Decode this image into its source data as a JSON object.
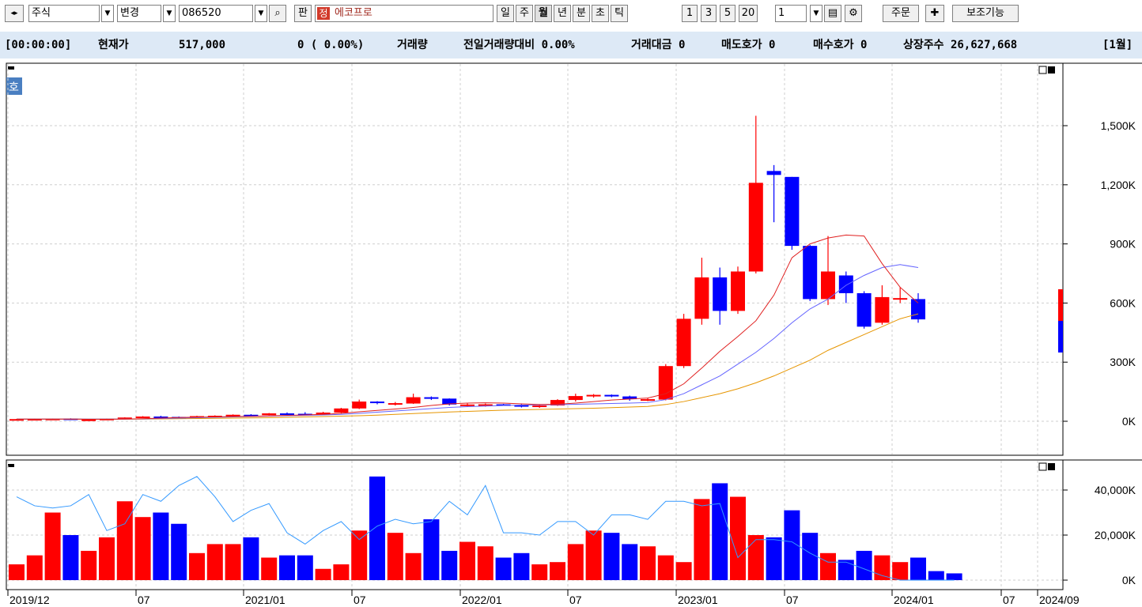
{
  "toolbar": {
    "market": "주식",
    "mode": "변경",
    "code": "086520",
    "pan_label": "판",
    "name_badge": "정",
    "stock_name": "에코프로",
    "periods": [
      "일",
      "주",
      "월",
      "년",
      "분",
      "초",
      "틱"
    ],
    "active_period": "월",
    "ranges": [
      "1",
      "3",
      "5",
      "20"
    ],
    "count": "1",
    "order_label": "주문",
    "aux_label": "보조기능"
  },
  "infobar": {
    "time": "[00:00:00]",
    "price_label": "현재가",
    "price": "517,000",
    "change": "0 ( 0.00%)",
    "volume_label": "거래량",
    "vol_ratio": "전일거래량대비 0.00%",
    "value_traded": "거래대금 0",
    "ask": "매도호가 0",
    "bid": "매수호가 0",
    "shares": "상장주수 26,627,668",
    "period": "[1월]"
  },
  "chart_data": {
    "type": "candlestick",
    "y_ticks": [
      "1,500K",
      "1,200K",
      "900K",
      "600K",
      "300K",
      "0K"
    ],
    "vol_ticks": [
      "40,000K",
      "20,000K",
      "0K"
    ],
    "x_labels": [
      "2019/12",
      "07",
      "2021/01",
      "07",
      "2022/01",
      "07",
      "2023/01",
      "07",
      "2024/01",
      "07",
      "2024/09"
    ],
    "candles": [
      {
        "o": 11,
        "h": 12,
        "l": 10,
        "c": 11,
        "up": true
      },
      {
        "o": 12,
        "h": 13,
        "l": 11,
        "c": 12,
        "up": true
      },
      {
        "o": 13,
        "h": 14,
        "l": 11,
        "c": 12,
        "up": true
      },
      {
        "o": 14,
        "h": 15,
        "l": 6,
        "c": 7,
        "up": false
      },
      {
        "o": 8,
        "h": 10,
        "l": 6,
        "c": 9,
        "up": true
      },
      {
        "o": 10,
        "h": 14,
        "l": 9,
        "c": 13,
        "up": true
      },
      {
        "o": 13,
        "h": 20,
        "l": 12,
        "c": 19,
        "up": true
      },
      {
        "o": 19,
        "h": 26,
        "l": 18,
        "c": 24,
        "up": true
      },
      {
        "o": 24,
        "h": 28,
        "l": 20,
        "c": 22,
        "up": false
      },
      {
        "o": 22,
        "h": 24,
        "l": 18,
        "c": 20,
        "up": false
      },
      {
        "o": 20,
        "h": 28,
        "l": 19,
        "c": 26,
        "up": true
      },
      {
        "o": 26,
        "h": 30,
        "l": 24,
        "c": 28,
        "up": true
      },
      {
        "o": 28,
        "h": 35,
        "l": 27,
        "c": 33,
        "up": true
      },
      {
        "o": 33,
        "h": 36,
        "l": 29,
        "c": 31,
        "up": false
      },
      {
        "o": 31,
        "h": 42,
        "l": 30,
        "c": 40,
        "up": true
      },
      {
        "o": 40,
        "h": 45,
        "l": 36,
        "c": 38,
        "up": false
      },
      {
        "o": 38,
        "h": 46,
        "l": 33,
        "c": 35,
        "up": false
      },
      {
        "o": 35,
        "h": 48,
        "l": 33,
        "c": 44,
        "up": true
      },
      {
        "o": 44,
        "h": 68,
        "l": 42,
        "c": 65,
        "up": true
      },
      {
        "o": 65,
        "h": 110,
        "l": 62,
        "c": 100,
        "up": true
      },
      {
        "o": 100,
        "h": 102,
        "l": 86,
        "c": 92,
        "up": false
      },
      {
        "o": 92,
        "h": 98,
        "l": 80,
        "c": 90,
        "up": true
      },
      {
        "o": 90,
        "h": 140,
        "l": 88,
        "c": 122,
        "up": true
      },
      {
        "o": 122,
        "h": 126,
        "l": 108,
        "c": 115,
        "up": false
      },
      {
        "o": 115,
        "h": 116,
        "l": 80,
        "c": 85,
        "up": false
      },
      {
        "o": 85,
        "h": 90,
        "l": 75,
        "c": 80,
        "up": true
      },
      {
        "o": 80,
        "h": 90,
        "l": 74,
        "c": 86,
        "up": true
      },
      {
        "o": 86,
        "h": 88,
        "l": 80,
        "c": 82,
        "up": false
      },
      {
        "o": 82,
        "h": 88,
        "l": 70,
        "c": 75,
        "up": false
      },
      {
        "o": 75,
        "h": 85,
        "l": 68,
        "c": 80,
        "up": true
      },
      {
        "o": 80,
        "h": 112,
        "l": 78,
        "c": 108,
        "up": true
      },
      {
        "o": 108,
        "h": 140,
        "l": 100,
        "c": 128,
        "up": true
      },
      {
        "o": 128,
        "h": 138,
        "l": 120,
        "c": 134,
        "up": true
      },
      {
        "o": 134,
        "h": 136,
        "l": 122,
        "c": 126,
        "up": false
      },
      {
        "o": 126,
        "h": 130,
        "l": 104,
        "c": 112,
        "up": false
      },
      {
        "o": 112,
        "h": 118,
        "l": 102,
        "c": 110,
        "up": true
      },
      {
        "o": 110,
        "h": 290,
        "l": 106,
        "c": 280,
        "up": true
      },
      {
        "o": 280,
        "h": 545,
        "l": 270,
        "c": 520,
        "up": true
      },
      {
        "o": 520,
        "h": 830,
        "l": 490,
        "c": 730,
        "up": true
      },
      {
        "o": 730,
        "h": 780,
        "l": 490,
        "c": 560,
        "up": false
      },
      {
        "o": 560,
        "h": 785,
        "l": 545,
        "c": 760,
        "up": true
      },
      {
        "o": 760,
        "h": 1550,
        "l": 750,
        "c": 1210,
        "up": true
      },
      {
        "o": 1270,
        "h": 1300,
        "l": 1010,
        "c": 1250,
        "up": false
      },
      {
        "o": 1240,
        "h": 1240,
        "l": 870,
        "c": 890,
        "up": false
      },
      {
        "o": 890,
        "h": 895,
        "l": 610,
        "c": 620,
        "up": false
      },
      {
        "o": 620,
        "h": 940,
        "l": 590,
        "c": 760,
        "up": true
      },
      {
        "o": 740,
        "h": 760,
        "l": 600,
        "c": 650,
        "up": false
      },
      {
        "o": 650,
        "h": 660,
        "l": 470,
        "c": 480,
        "up": false
      },
      {
        "o": 500,
        "h": 690,
        "l": 490,
        "c": 630,
        "up": true
      },
      {
        "o": 620,
        "h": 680,
        "l": 600,
        "c": 625,
        "up": true
      },
      {
        "o": 620,
        "h": 650,
        "l": 500,
        "c": 517,
        "up": false
      }
    ],
    "ma_red": [
      11,
      11,
      11,
      11,
      10,
      10,
      11,
      13,
      16,
      19,
      21,
      22,
      24,
      25,
      27,
      30,
      32,
      35,
      40,
      48,
      55,
      62,
      70,
      80,
      88,
      92,
      94,
      92,
      88,
      85,
      86,
      92,
      100,
      108,
      113,
      118,
      140,
      190,
      270,
      355,
      430,
      510,
      640,
      830,
      900,
      930,
      945,
      940,
      800,
      680,
      600
    ],
    "ma_blue": [
      11,
      11,
      11,
      11,
      11,
      11,
      11,
      12,
      14,
      16,
      18,
      20,
      22,
      24,
      26,
      28,
      30,
      32,
      35,
      40,
      46,
      52,
      58,
      64,
      70,
      74,
      77,
      80,
      82,
      83,
      84,
      86,
      88,
      90,
      92,
      95,
      110,
      140,
      185,
      230,
      290,
      350,
      420,
      500,
      570,
      620,
      690,
      740,
      780,
      795,
      780
    ],
    "ma_orange": [
      11,
      11,
      11,
      11,
      11,
      11,
      11,
      11,
      12,
      13,
      14,
      15,
      16,
      17,
      18,
      20,
      22,
      24,
      26,
      28,
      31,
      35,
      39,
      43,
      47,
      50,
      53,
      56,
      58,
      60,
      62,
      64,
      66,
      69,
      72,
      75,
      85,
      100,
      120,
      140,
      165,
      195,
      230,
      270,
      310,
      360,
      400,
      440,
      480,
      520,
      545
    ],
    "volume": [
      7,
      11,
      30,
      20,
      13,
      19,
      35,
      28,
      30,
      25,
      12,
      16,
      16,
      19,
      10,
      11,
      11,
      5,
      7,
      22,
      46,
      21,
      12,
      27,
      13,
      17,
      15,
      10,
      12,
      7,
      8,
      16,
      22,
      21,
      16,
      15,
      11,
      8,
      36,
      43,
      37,
      20,
      19,
      31,
      21,
      12,
      9,
      13,
      11,
      8,
      10,
      4,
      3
    ],
    "vol_ma": [
      37,
      33,
      32,
      33,
      38,
      22,
      25,
      38,
      35,
      42,
      46,
      37,
      26,
      31,
      34,
      21,
      16,
      22,
      26,
      18,
      24,
      27,
      25,
      26,
      35,
      29,
      42,
      21,
      21,
      20,
      26,
      26,
      20,
      29,
      29,
      27,
      35,
      35,
      33,
      34,
      10,
      18,
      18,
      17,
      12,
      8,
      8,
      5,
      2,
      0,
      0,
      0,
      0
    ],
    "y_max": 1800,
    "vol_max": 52
  },
  "colors": {
    "up": "#ff0000",
    "down": "#0000ff",
    "ma_red": "#e02020",
    "ma_blue": "#6464ff",
    "ma_orange": "#e69500",
    "vol_ma": "#3399ff"
  }
}
